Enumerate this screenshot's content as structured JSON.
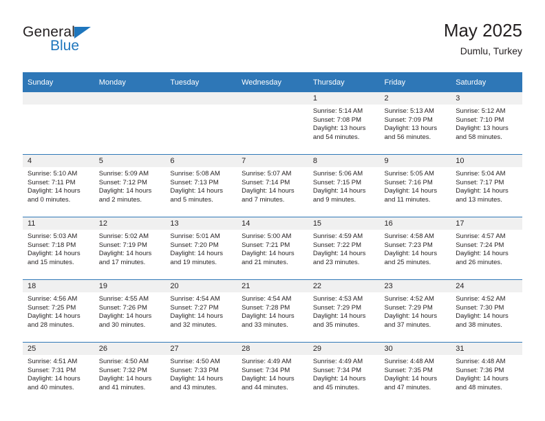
{
  "brand": {
    "name_part1": "General",
    "name_part2": "Blue",
    "logo_icon": "triangle-flag-icon"
  },
  "header": {
    "title": "May 2025",
    "subtitle": "Dumlu, Turkey"
  },
  "colors": {
    "header_blue": "#2e77b7",
    "daynum_band": "#f0f0f0",
    "text": "#231f20",
    "brand_blue": "#1e76bd"
  },
  "calendar": {
    "weekday_headers": [
      "Sunday",
      "Monday",
      "Tuesday",
      "Wednesday",
      "Thursday",
      "Friday",
      "Saturday"
    ],
    "weeks": [
      [
        {
          "day": "",
          "sunrise": "",
          "sunset": "",
          "daylight_line1": "",
          "daylight_line2": "",
          "empty": true
        },
        {
          "day": "",
          "sunrise": "",
          "sunset": "",
          "daylight_line1": "",
          "daylight_line2": "",
          "empty": true
        },
        {
          "day": "",
          "sunrise": "",
          "sunset": "",
          "daylight_line1": "",
          "daylight_line2": "",
          "empty": true
        },
        {
          "day": "",
          "sunrise": "",
          "sunset": "",
          "daylight_line1": "",
          "daylight_line2": "",
          "empty": true
        },
        {
          "day": "1",
          "sunrise": "Sunrise: 5:14 AM",
          "sunset": "Sunset: 7:08 PM",
          "daylight_line1": "Daylight: 13 hours",
          "daylight_line2": "and 54 minutes."
        },
        {
          "day": "2",
          "sunrise": "Sunrise: 5:13 AM",
          "sunset": "Sunset: 7:09 PM",
          "daylight_line1": "Daylight: 13 hours",
          "daylight_line2": "and 56 minutes."
        },
        {
          "day": "3",
          "sunrise": "Sunrise: 5:12 AM",
          "sunset": "Sunset: 7:10 PM",
          "daylight_line1": "Daylight: 13 hours",
          "daylight_line2": "and 58 minutes."
        }
      ],
      [
        {
          "day": "4",
          "sunrise": "Sunrise: 5:10 AM",
          "sunset": "Sunset: 7:11 PM",
          "daylight_line1": "Daylight: 14 hours",
          "daylight_line2": "and 0 minutes."
        },
        {
          "day": "5",
          "sunrise": "Sunrise: 5:09 AM",
          "sunset": "Sunset: 7:12 PM",
          "daylight_line1": "Daylight: 14 hours",
          "daylight_line2": "and 2 minutes."
        },
        {
          "day": "6",
          "sunrise": "Sunrise: 5:08 AM",
          "sunset": "Sunset: 7:13 PM",
          "daylight_line1": "Daylight: 14 hours",
          "daylight_line2": "and 5 minutes."
        },
        {
          "day": "7",
          "sunrise": "Sunrise: 5:07 AM",
          "sunset": "Sunset: 7:14 PM",
          "daylight_line1": "Daylight: 14 hours",
          "daylight_line2": "and 7 minutes."
        },
        {
          "day": "8",
          "sunrise": "Sunrise: 5:06 AM",
          "sunset": "Sunset: 7:15 PM",
          "daylight_line1": "Daylight: 14 hours",
          "daylight_line2": "and 9 minutes."
        },
        {
          "day": "9",
          "sunrise": "Sunrise: 5:05 AM",
          "sunset": "Sunset: 7:16 PM",
          "daylight_line1": "Daylight: 14 hours",
          "daylight_line2": "and 11 minutes."
        },
        {
          "day": "10",
          "sunrise": "Sunrise: 5:04 AM",
          "sunset": "Sunset: 7:17 PM",
          "daylight_line1": "Daylight: 14 hours",
          "daylight_line2": "and 13 minutes."
        }
      ],
      [
        {
          "day": "11",
          "sunrise": "Sunrise: 5:03 AM",
          "sunset": "Sunset: 7:18 PM",
          "daylight_line1": "Daylight: 14 hours",
          "daylight_line2": "and 15 minutes."
        },
        {
          "day": "12",
          "sunrise": "Sunrise: 5:02 AM",
          "sunset": "Sunset: 7:19 PM",
          "daylight_line1": "Daylight: 14 hours",
          "daylight_line2": "and 17 minutes."
        },
        {
          "day": "13",
          "sunrise": "Sunrise: 5:01 AM",
          "sunset": "Sunset: 7:20 PM",
          "daylight_line1": "Daylight: 14 hours",
          "daylight_line2": "and 19 minutes."
        },
        {
          "day": "14",
          "sunrise": "Sunrise: 5:00 AM",
          "sunset": "Sunset: 7:21 PM",
          "daylight_line1": "Daylight: 14 hours",
          "daylight_line2": "and 21 minutes."
        },
        {
          "day": "15",
          "sunrise": "Sunrise: 4:59 AM",
          "sunset": "Sunset: 7:22 PM",
          "daylight_line1": "Daylight: 14 hours",
          "daylight_line2": "and 23 minutes."
        },
        {
          "day": "16",
          "sunrise": "Sunrise: 4:58 AM",
          "sunset": "Sunset: 7:23 PM",
          "daylight_line1": "Daylight: 14 hours",
          "daylight_line2": "and 25 minutes."
        },
        {
          "day": "17",
          "sunrise": "Sunrise: 4:57 AM",
          "sunset": "Sunset: 7:24 PM",
          "daylight_line1": "Daylight: 14 hours",
          "daylight_line2": "and 26 minutes."
        }
      ],
      [
        {
          "day": "18",
          "sunrise": "Sunrise: 4:56 AM",
          "sunset": "Sunset: 7:25 PM",
          "daylight_line1": "Daylight: 14 hours",
          "daylight_line2": "and 28 minutes."
        },
        {
          "day": "19",
          "sunrise": "Sunrise: 4:55 AM",
          "sunset": "Sunset: 7:26 PM",
          "daylight_line1": "Daylight: 14 hours",
          "daylight_line2": "and 30 minutes."
        },
        {
          "day": "20",
          "sunrise": "Sunrise: 4:54 AM",
          "sunset": "Sunset: 7:27 PM",
          "daylight_line1": "Daylight: 14 hours",
          "daylight_line2": "and 32 minutes."
        },
        {
          "day": "21",
          "sunrise": "Sunrise: 4:54 AM",
          "sunset": "Sunset: 7:28 PM",
          "daylight_line1": "Daylight: 14 hours",
          "daylight_line2": "and 33 minutes."
        },
        {
          "day": "22",
          "sunrise": "Sunrise: 4:53 AM",
          "sunset": "Sunset: 7:29 PM",
          "daylight_line1": "Daylight: 14 hours",
          "daylight_line2": "and 35 minutes."
        },
        {
          "day": "23",
          "sunrise": "Sunrise: 4:52 AM",
          "sunset": "Sunset: 7:29 PM",
          "daylight_line1": "Daylight: 14 hours",
          "daylight_line2": "and 37 minutes."
        },
        {
          "day": "24",
          "sunrise": "Sunrise: 4:52 AM",
          "sunset": "Sunset: 7:30 PM",
          "daylight_line1": "Daylight: 14 hours",
          "daylight_line2": "and 38 minutes."
        }
      ],
      [
        {
          "day": "25",
          "sunrise": "Sunrise: 4:51 AM",
          "sunset": "Sunset: 7:31 PM",
          "daylight_line1": "Daylight: 14 hours",
          "daylight_line2": "and 40 minutes."
        },
        {
          "day": "26",
          "sunrise": "Sunrise: 4:50 AM",
          "sunset": "Sunset: 7:32 PM",
          "daylight_line1": "Daylight: 14 hours",
          "daylight_line2": "and 41 minutes."
        },
        {
          "day": "27",
          "sunrise": "Sunrise: 4:50 AM",
          "sunset": "Sunset: 7:33 PM",
          "daylight_line1": "Daylight: 14 hours",
          "daylight_line2": "and 43 minutes."
        },
        {
          "day": "28",
          "sunrise": "Sunrise: 4:49 AM",
          "sunset": "Sunset: 7:34 PM",
          "daylight_line1": "Daylight: 14 hours",
          "daylight_line2": "and 44 minutes."
        },
        {
          "day": "29",
          "sunrise": "Sunrise: 4:49 AM",
          "sunset": "Sunset: 7:34 PM",
          "daylight_line1": "Daylight: 14 hours",
          "daylight_line2": "and 45 minutes."
        },
        {
          "day": "30",
          "sunrise": "Sunrise: 4:48 AM",
          "sunset": "Sunset: 7:35 PM",
          "daylight_line1": "Daylight: 14 hours",
          "daylight_line2": "and 47 minutes."
        },
        {
          "day": "31",
          "sunrise": "Sunrise: 4:48 AM",
          "sunset": "Sunset: 7:36 PM",
          "daylight_line1": "Daylight: 14 hours",
          "daylight_line2": "and 48 minutes."
        }
      ]
    ]
  }
}
